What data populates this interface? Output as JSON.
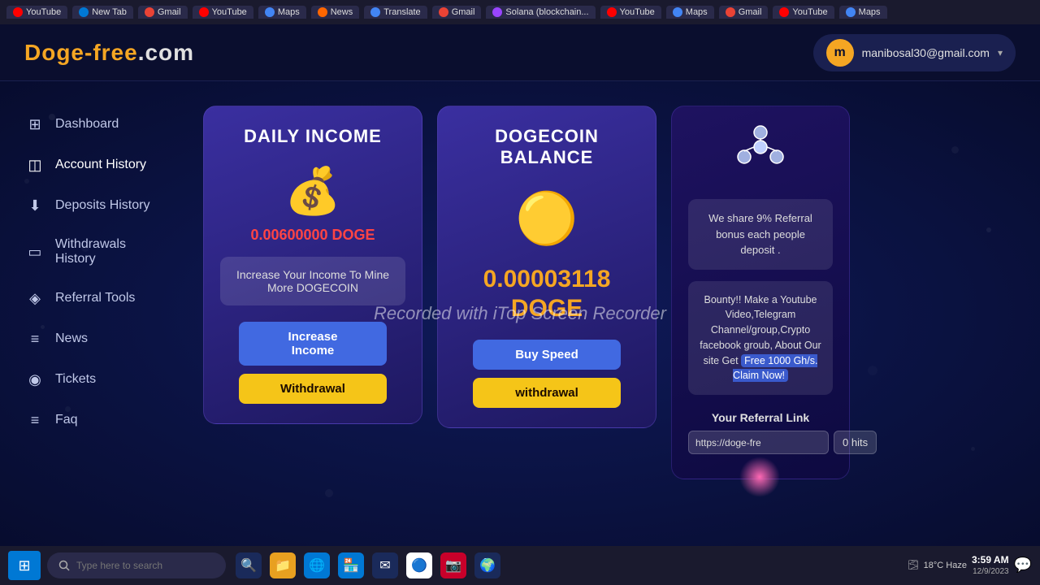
{
  "browser": {
    "tabs": [
      {
        "icon": "yt",
        "label": "YouTube"
      },
      {
        "icon": "edge",
        "label": "New Tab"
      },
      {
        "icon": "gm",
        "label": "Gmail"
      },
      {
        "icon": "yt",
        "label": "YouTube"
      },
      {
        "icon": "maps",
        "label": "Maps"
      },
      {
        "icon": "news",
        "label": "News"
      },
      {
        "icon": "tr",
        "label": "Translate"
      },
      {
        "icon": "gm",
        "label": "Gmail"
      },
      {
        "icon": "sol",
        "label": "Solana (blockchain..."
      },
      {
        "icon": "yt",
        "label": "YouTube"
      },
      {
        "icon": "maps",
        "label": "Maps"
      },
      {
        "icon": "gm",
        "label": "Gmail"
      },
      {
        "icon": "yt",
        "label": "YouTube"
      },
      {
        "icon": "maps",
        "label": "Maps"
      }
    ]
  },
  "header": {
    "logo": "Doge-free",
    "logo_suffix": ".com",
    "user_email": "manibosal30@gmail.com",
    "user_initial": "m"
  },
  "sidebar": {
    "items": [
      {
        "label": "Dashboard",
        "icon": "dashboard"
      },
      {
        "label": "Account History",
        "icon": "history"
      },
      {
        "label": "Deposits History",
        "icon": "deposits"
      },
      {
        "label": "Withdrawals History",
        "icon": "withdrawals"
      },
      {
        "label": "Referral Tools",
        "icon": "referral"
      },
      {
        "label": "News",
        "icon": "news"
      },
      {
        "label": "Tickets",
        "icon": "tickets"
      },
      {
        "label": "Faq",
        "icon": "faq"
      }
    ]
  },
  "daily_income_card": {
    "title": "DAILY INCOME",
    "amount": "0.00600000 DOGE",
    "info_text": "Increase Your Income To Mine More DOGECOIN",
    "btn_increase": "Increase Income",
    "btn_withdrawal": "Withdrawal"
  },
  "dogecoin_balance_card": {
    "title": "DOGECOIN BALANCE",
    "balance": "0.00003118",
    "currency": "DOGE",
    "btn_buy": "Buy Speed",
    "btn_withdrawal": "withdrawal"
  },
  "referral_card": {
    "referral_bonus_text": "We share 9% Referral bonus each people deposit .",
    "bounty_text": "Bounty!! Make a Youtube Video,Telegram Channel/group,Crypto facebook groub, About Our site Get Free 1000 Gh/s. Claim Now!",
    "referral_link_label": "Your Referral Link",
    "referral_link_value": "https://doge-fre",
    "hits_label": "0 hits"
  },
  "watermark": "Recorded with iTop Screen Recorder",
  "taskbar": {
    "search_placeholder": "Type here to search",
    "time": "3:59 AM",
    "date": "12/9/2023",
    "weather": "18°C  Haze"
  }
}
